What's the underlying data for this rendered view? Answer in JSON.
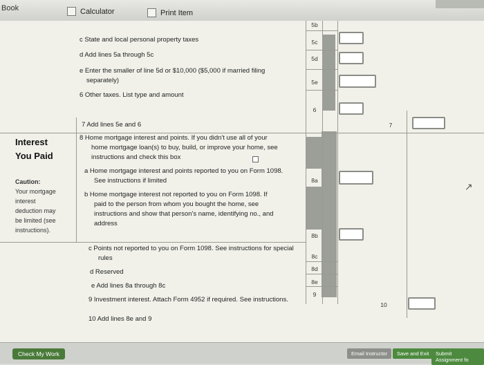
{
  "topbar": {
    "book": "Book",
    "calculator": "Calculator",
    "print_item": "Print Item"
  },
  "form": {
    "line5c": "c  State and local personal property taxes",
    "line5d": "d  Add lines 5a through 5c",
    "line5e_1": "e  Enter the smaller of line 5d or $10,000 ($5,000 if married filing",
    "line5e_2": "separately)",
    "line6": "6  Other taxes. List type and amount",
    "line7": "7  Add lines 5e and 6",
    "interest_title_1": "Interest",
    "interest_title_2": "You Paid",
    "line8_1": "8  Home mortgage interest and points. If you didn't use all of your",
    "line8_2": "home mortgage loan(s) to buy, build, or improve your home, see",
    "line8_3": "instructions and check this box",
    "line8a_1": "a  Home mortgage interest and points reported to you on Form 1098.",
    "line8a_2": "See instructions if limited",
    "caution": "Caution:",
    "caution_1": "Your mortgage",
    "caution_2": "interest",
    "caution_3": "deduction may",
    "caution_4": "be limited (see",
    "caution_5": "instructions).",
    "line8b_1": "b  Home mortgage interest not reported to you on Form 1098. If",
    "line8b_2": "paid to the person from whom you bought the home, see",
    "line8b_3": "instructions and show that person's name, identifying no., and",
    "line8b_4": "address",
    "line8c_1": "c  Points not reported to you on Form 1098. See instructions for special",
    "line8c_2": "rules",
    "line8d": "d  Reserved",
    "line8e": "e  Add lines 8a through 8c",
    "line9": "9  Investment interest. Attach Form 4952 if required. See instructions.",
    "line10": "10  Add lines 8e and 9",
    "labels": {
      "l5b": "5b",
      "l5c": "5c",
      "l5d": "5d",
      "l5e": "5e",
      "l6": "6",
      "l7": "7",
      "l8a": "8a",
      "l8b": "8b",
      "l8c": "8c",
      "l8d": "8d",
      "l8e": "8e",
      "l9": "9",
      "l10": "10"
    }
  },
  "bottombar": {
    "check": "Check My Work",
    "email": "Email Instructor",
    "save": "Save and Exit",
    "submit": "Submit Assignment fo"
  }
}
